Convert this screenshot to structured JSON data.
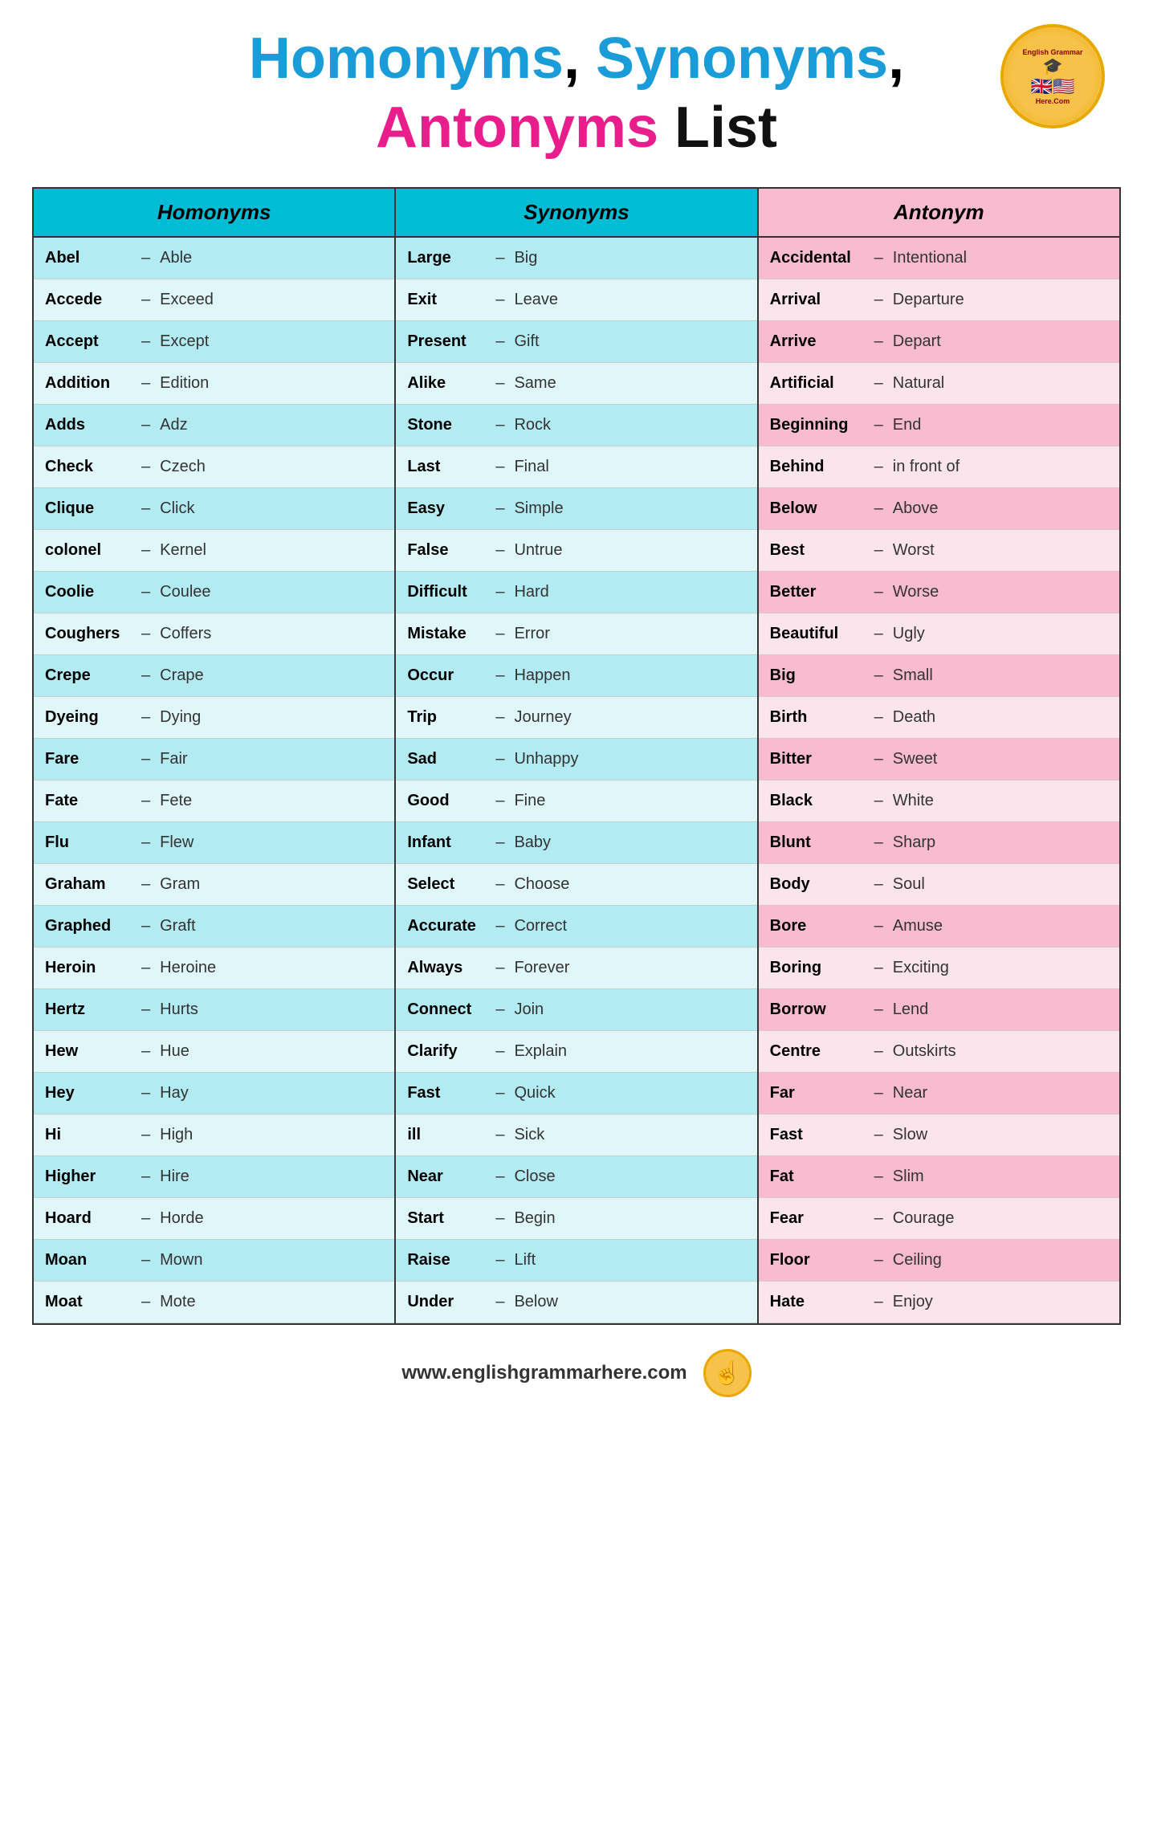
{
  "title": {
    "line1": "Homonyms, Synonyms,",
    "line2": "Antonyms List",
    "word_homonyms": "Homonyms",
    "word_synonyms": "Synonyms",
    "word_antonyms": "Antonyms",
    "word_list": " List",
    "comma1": ",",
    "comma2": ","
  },
  "logo": {
    "text": "English Grammar Here.Com"
  },
  "homonyms": {
    "header": "Homonyms",
    "rows": [
      {
        "word": "Abel",
        "meaning": "Able"
      },
      {
        "word": "Accede",
        "meaning": "Exceed"
      },
      {
        "word": "Accept",
        "meaning": "Except"
      },
      {
        "word": "Addition",
        "meaning": "Edition"
      },
      {
        "word": "Adds",
        "meaning": "Adz"
      },
      {
        "word": "Check",
        "meaning": "Czech"
      },
      {
        "word": "Clique",
        "meaning": "Click"
      },
      {
        "word": "colonel",
        "meaning": "Kernel"
      },
      {
        "word": "Coolie",
        "meaning": "Coulee"
      },
      {
        "word": "Coughers",
        "meaning": "Coffers"
      },
      {
        "word": "Crepe",
        "meaning": "Crape"
      },
      {
        "word": "Dyeing",
        "meaning": "Dying"
      },
      {
        "word": "Fare",
        "meaning": "Fair"
      },
      {
        "word": "Fate",
        "meaning": "Fete"
      },
      {
        "word": "Flu",
        "meaning": "Flew"
      },
      {
        "word": "Graham",
        "meaning": "Gram"
      },
      {
        "word": "Graphed",
        "meaning": "Graft"
      },
      {
        "word": "Heroin",
        "meaning": "Heroine"
      },
      {
        "word": "Hertz",
        "meaning": "Hurts"
      },
      {
        "word": "Hew",
        "meaning": "Hue"
      },
      {
        "word": "Hey",
        "meaning": "Hay"
      },
      {
        "word": "Hi",
        "meaning": "High"
      },
      {
        "word": "Higher",
        "meaning": "Hire"
      },
      {
        "word": "Hoard",
        "meaning": "Horde"
      },
      {
        "word": "Moan",
        "meaning": "Mown"
      },
      {
        "word": "Moat",
        "meaning": "Mote"
      }
    ]
  },
  "synonyms": {
    "header": "Synonyms",
    "rows": [
      {
        "word": "Large",
        "meaning": "Big"
      },
      {
        "word": "Exit",
        "meaning": "Leave"
      },
      {
        "word": "Present",
        "meaning": "Gift"
      },
      {
        "word": "Alike",
        "meaning": "Same"
      },
      {
        "word": "Stone",
        "meaning": "Rock"
      },
      {
        "word": "Last",
        "meaning": "Final"
      },
      {
        "word": "Easy",
        "meaning": "Simple"
      },
      {
        "word": "False",
        "meaning": "Untrue"
      },
      {
        "word": "Difficult",
        "meaning": "Hard"
      },
      {
        "word": "Mistake",
        "meaning": "Error"
      },
      {
        "word": "Occur",
        "meaning": "Happen"
      },
      {
        "word": "Trip",
        "meaning": "Journey"
      },
      {
        "word": "Sad",
        "meaning": "Unhappy"
      },
      {
        "word": "Good",
        "meaning": "Fine"
      },
      {
        "word": "Infant",
        "meaning": "Baby"
      },
      {
        "word": "Select",
        "meaning": "Choose"
      },
      {
        "word": "Accurate",
        "meaning": "Correct"
      },
      {
        "word": "Always",
        "meaning": "Forever"
      },
      {
        "word": "Connect",
        "meaning": "Join"
      },
      {
        "word": "Clarify",
        "meaning": "Explain"
      },
      {
        "word": "Fast",
        "meaning": "Quick"
      },
      {
        "word": "ill",
        "meaning": "Sick"
      },
      {
        "word": "Near",
        "meaning": "Close"
      },
      {
        "word": "Start",
        "meaning": "Begin"
      },
      {
        "word": "Raise",
        "meaning": "Lift"
      },
      {
        "word": "Under",
        "meaning": "Below"
      }
    ]
  },
  "antonyms": {
    "header": "Antonym",
    "rows": [
      {
        "word": "Accidental",
        "meaning": "Intentional"
      },
      {
        "word": "Arrival",
        "meaning": "Departure"
      },
      {
        "word": "Arrive",
        "meaning": "Depart"
      },
      {
        "word": "Artificial",
        "meaning": "Natural"
      },
      {
        "word": "Beginning",
        "meaning": "End"
      },
      {
        "word": "Behind",
        "meaning": "in front of"
      },
      {
        "word": "Below",
        "meaning": "Above"
      },
      {
        "word": "Best",
        "meaning": "Worst"
      },
      {
        "word": "Better",
        "meaning": "Worse"
      },
      {
        "word": "Beautiful",
        "meaning": "Ugly"
      },
      {
        "word": "Big",
        "meaning": "Small"
      },
      {
        "word": "Birth",
        "meaning": "Death"
      },
      {
        "word": "Bitter",
        "meaning": "Sweet"
      },
      {
        "word": "Black",
        "meaning": "White"
      },
      {
        "word": "Blunt",
        "meaning": "Sharp"
      },
      {
        "word": "Body",
        "meaning": "Soul"
      },
      {
        "word": "Bore",
        "meaning": "Amuse"
      },
      {
        "word": "Boring",
        "meaning": "Exciting"
      },
      {
        "word": "Borrow",
        "meaning": "Lend"
      },
      {
        "word": "Centre",
        "meaning": "Outskirts"
      },
      {
        "word": "Far",
        "meaning": "Near"
      },
      {
        "word": "Fast",
        "meaning": "Slow"
      },
      {
        "word": "Fat",
        "meaning": "Slim"
      },
      {
        "word": "Fear",
        "meaning": "Courage"
      },
      {
        "word": "Floor",
        "meaning": "Ceiling"
      },
      {
        "word": "Hate",
        "meaning": "Enjoy"
      }
    ]
  },
  "footer": {
    "url": "www.englishgrammarhere.com"
  }
}
